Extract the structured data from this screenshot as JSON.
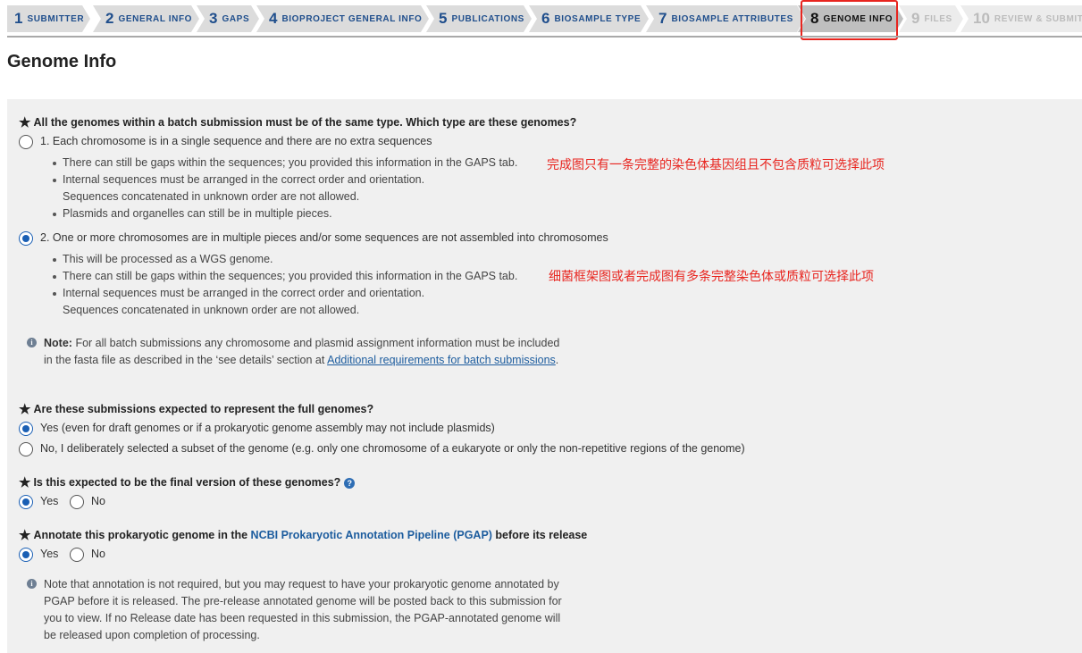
{
  "steps": [
    {
      "num": "1",
      "label": "SUBMITTER",
      "state": "done"
    },
    {
      "num": "2",
      "label": "GENERAL INFO",
      "state": "done"
    },
    {
      "num": "3",
      "label": "GAPS",
      "state": "done"
    },
    {
      "num": "4",
      "label": "BIOPROJECT GENERAL INFO",
      "state": "done"
    },
    {
      "num": "5",
      "label": "PUBLICATIONS",
      "state": "done"
    },
    {
      "num": "6",
      "label": "BIOSAMPLE TYPE",
      "state": "done"
    },
    {
      "num": "7",
      "label": "BIOSAMPLE ATTRIBUTES",
      "state": "done"
    },
    {
      "num": "8",
      "label": "GENOME INFO",
      "state": "active"
    },
    {
      "num": "9",
      "label": "FILES",
      "state": "disabled"
    },
    {
      "num": "10",
      "label": "REVIEW & SUBMIT",
      "state": "disabled"
    }
  ],
  "page_title": "Genome Info",
  "q1": {
    "star": "★",
    "text": "All the genomes within a batch submission must be of the same type. Which type are these genomes?",
    "option1": {
      "label": "1. Each chromosome is in a single sequence and there are no extra sequences",
      "selected": false,
      "bullets": [
        "There can still be gaps within the sequences; you provided this information in the GAPS tab.",
        "Internal sequences must be arranged in the correct order and orientation.",
        "Sequences concatenated in unknown order are not allowed.",
        "Plasmids and organelles can still be in multiple pieces."
      ]
    },
    "option2": {
      "label": "2. One or more chromosomes are in multiple pieces and/or some sequences are not assembled into chromosomes",
      "selected": true,
      "bullets": [
        "This will be processed as a WGS genome.",
        "There can still be gaps within the sequences; you provided this information in the GAPS tab.",
        "Internal sequences must be arranged in the correct order and orientation.",
        "Sequences concatenated in unknown order are not allowed."
      ]
    },
    "annotation1": "完成图只有一条完整的染色体基因组且不包含质粒可选择此项",
    "annotation2": "细菌框架图或者完成图有多条完整染色体或质粒可选择此项",
    "note": {
      "icon": "info-icon",
      "bold": "Note:",
      "text": "For all batch submissions any chromosome and plasmid assignment information must be included in the fasta file as described in the ‘see details’ section at",
      "link": "Additional requirements for batch submissions",
      "end": "."
    }
  },
  "q2": {
    "star": "★",
    "text": "Are these submissions expected to represent the full genomes?",
    "option_yes": "Yes (even for draft genomes or if a prokaryotic genome assembly may not include plasmids)",
    "option_no": "No, I deliberately selected a subset of the genome (e.g. only one chromosome of a eukaryote or only the non-repetitive regions of the genome)",
    "selected": "yes"
  },
  "q3": {
    "star": "★",
    "text": "Is this expected to be the final version of these genomes?",
    "help": "?",
    "yes": "Yes",
    "no": "No",
    "selected": "yes"
  },
  "q4": {
    "star": "★",
    "text_before": "Annotate this prokaryotic genome in the ",
    "link": "NCBI Prokaryotic Annotation Pipeline (PGAP)",
    "text_after": " before its release",
    "yes": "Yes",
    "no": "No",
    "selected": "yes",
    "note": "Note that annotation is not required, but you may request to have your prokaryotic genome annotated by PGAP before it is released. The pre-release annotated genome will be posted back to this submission for you to view. If no Release date has been requested in this submission, the PGAP-annotated genome will be released upon completion of processing."
  },
  "colors": {
    "accent": "#1a5fb4",
    "link": "#1c5c9e",
    "annotation": "#e8251f",
    "highlight_box": "#e8251f",
    "panel": "#f0f0f0"
  }
}
